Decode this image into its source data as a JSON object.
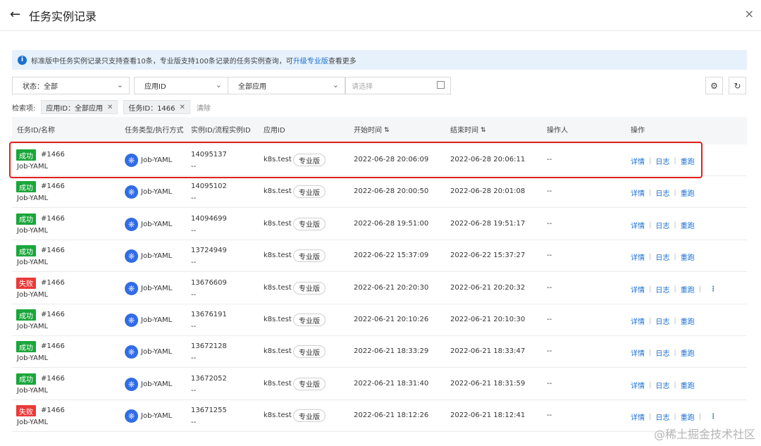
{
  "header": {
    "back": "←",
    "title": "任务实例记录",
    "close": "×"
  },
  "notice": {
    "icon": "info-icon",
    "text": "标准版中任务实例记录只支持查看10条，专业版支持100条记录的任务实例查询，可",
    "link": "升级专业版",
    "tail": "查看更多"
  },
  "filters": {
    "status": "状态：全部",
    "appid": "应用ID",
    "app": "全部应用",
    "date_placeholder": "请选择"
  },
  "criteria": {
    "label": "检索项:",
    "chips": [
      "应用ID：全部应用",
      "任务ID：1466"
    ],
    "clear": "清除"
  },
  "columns": {
    "task": "任务ID/名称",
    "type": "任务类型/执行方式",
    "instance": "实例ID/流程实例ID",
    "appid": "应用ID",
    "start": "开始时间",
    "end": "结束时间",
    "operator": "操作人",
    "actions": "操作"
  },
  "actions": {
    "detail": "详情",
    "log": "日志",
    "rerun": "重跑",
    "sep": "|",
    "more": "⋮"
  },
  "rows": [
    {
      "status": "成功",
      "ok": true,
      "id": "#1466",
      "name": "Job-YAML",
      "type": "Job-YAML",
      "inst": "14095137",
      "flow": "--",
      "app": "k8s.test",
      "tag": "专业版",
      "start": "2022-06-28 20:06:09",
      "end": "2022-06-28 20:06:11",
      "op": "--"
    },
    {
      "status": "成功",
      "ok": true,
      "id": "#1466",
      "name": "Job-YAML",
      "type": "Job-YAML",
      "inst": "14095102",
      "flow": "--",
      "app": "k8s.test",
      "tag": "专业版",
      "start": "2022-06-28 20:00:50",
      "end": "2022-06-28 20:01:08",
      "op": "--"
    },
    {
      "status": "成功",
      "ok": true,
      "id": "#1466",
      "name": "Job-YAML",
      "type": "Job-YAML",
      "inst": "14094699",
      "flow": "--",
      "app": "k8s.test",
      "tag": "专业版",
      "start": "2022-06-28 19:51:00",
      "end": "2022-06-28 19:51:17",
      "op": "--"
    },
    {
      "status": "成功",
      "ok": true,
      "id": "#1466",
      "name": "Job-YAML",
      "type": "Job-YAML",
      "inst": "13724949",
      "flow": "--",
      "app": "k8s.test",
      "tag": "专业版",
      "start": "2022-06-22 15:37:09",
      "end": "2022-06-22 15:37:27",
      "op": "--"
    },
    {
      "status": "失败",
      "ok": false,
      "id": "#1466",
      "name": "Job-YAML",
      "type": "Job-YAML",
      "inst": "13676609",
      "flow": "--",
      "app": "k8s.test",
      "tag": "专业版",
      "start": "2022-06-21 20:20:30",
      "end": "2022-06-21 20:20:32",
      "op": "--"
    },
    {
      "status": "成功",
      "ok": true,
      "id": "#1466",
      "name": "Job-YAML",
      "type": "Job-YAML",
      "inst": "13676191",
      "flow": "--",
      "app": "k8s.test",
      "tag": "专业版",
      "start": "2022-06-21 20:10:26",
      "end": "2022-06-21 20:10:30",
      "op": "--"
    },
    {
      "status": "成功",
      "ok": true,
      "id": "#1466",
      "name": "Job-YAML",
      "type": "Job-YAML",
      "inst": "13672128",
      "flow": "--",
      "app": "k8s.test",
      "tag": "专业版",
      "start": "2022-06-21 18:33:29",
      "end": "2022-06-21 18:33:47",
      "op": "--"
    },
    {
      "status": "成功",
      "ok": true,
      "id": "#1466",
      "name": "Job-YAML",
      "type": "Job-YAML",
      "inst": "13672052",
      "flow": "--",
      "app": "k8s.test",
      "tag": "专业版",
      "start": "2022-06-21 18:31:40",
      "end": "2022-06-21 18:31:59",
      "op": "--"
    },
    {
      "status": "失败",
      "ok": false,
      "id": "#1466",
      "name": "Job-YAML",
      "type": "Job-YAML",
      "inst": "13671255",
      "flow": "--",
      "app": "k8s.test",
      "tag": "专业版",
      "start": "2022-06-21 18:12:26",
      "end": "2022-06-21 18:12:41",
      "op": "--"
    }
  ],
  "watermark": "@稀土掘金技术社区"
}
